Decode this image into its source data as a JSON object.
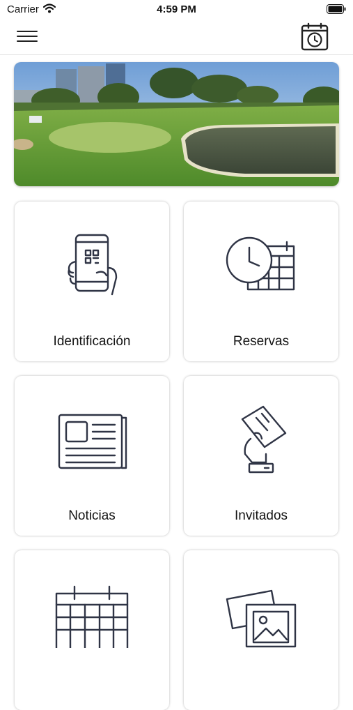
{
  "status": {
    "carrier": "Carrier",
    "time": "4:59 PM"
  },
  "icons": {
    "menu": "hamburger-menu-icon",
    "calendar": "calendar-clock-icon"
  },
  "hero": {
    "image": "golf course with pond and city buildings"
  },
  "tiles": [
    {
      "label": "Identificación",
      "icon": "phone-qr-code-icon"
    },
    {
      "label": "Reservas",
      "icon": "clock-calendar-icon"
    },
    {
      "label": "Noticias",
      "icon": "newspaper-icon"
    },
    {
      "label": "Invitados",
      "icon": "hand-holding-ticket-icon"
    },
    {
      "label": "",
      "icon": "calendar-grid-icon"
    },
    {
      "label": "",
      "icon": "photo-gallery-icon"
    }
  ],
  "colors": {
    "icon_stroke": "#2f3445",
    "background": "#ffffff"
  }
}
